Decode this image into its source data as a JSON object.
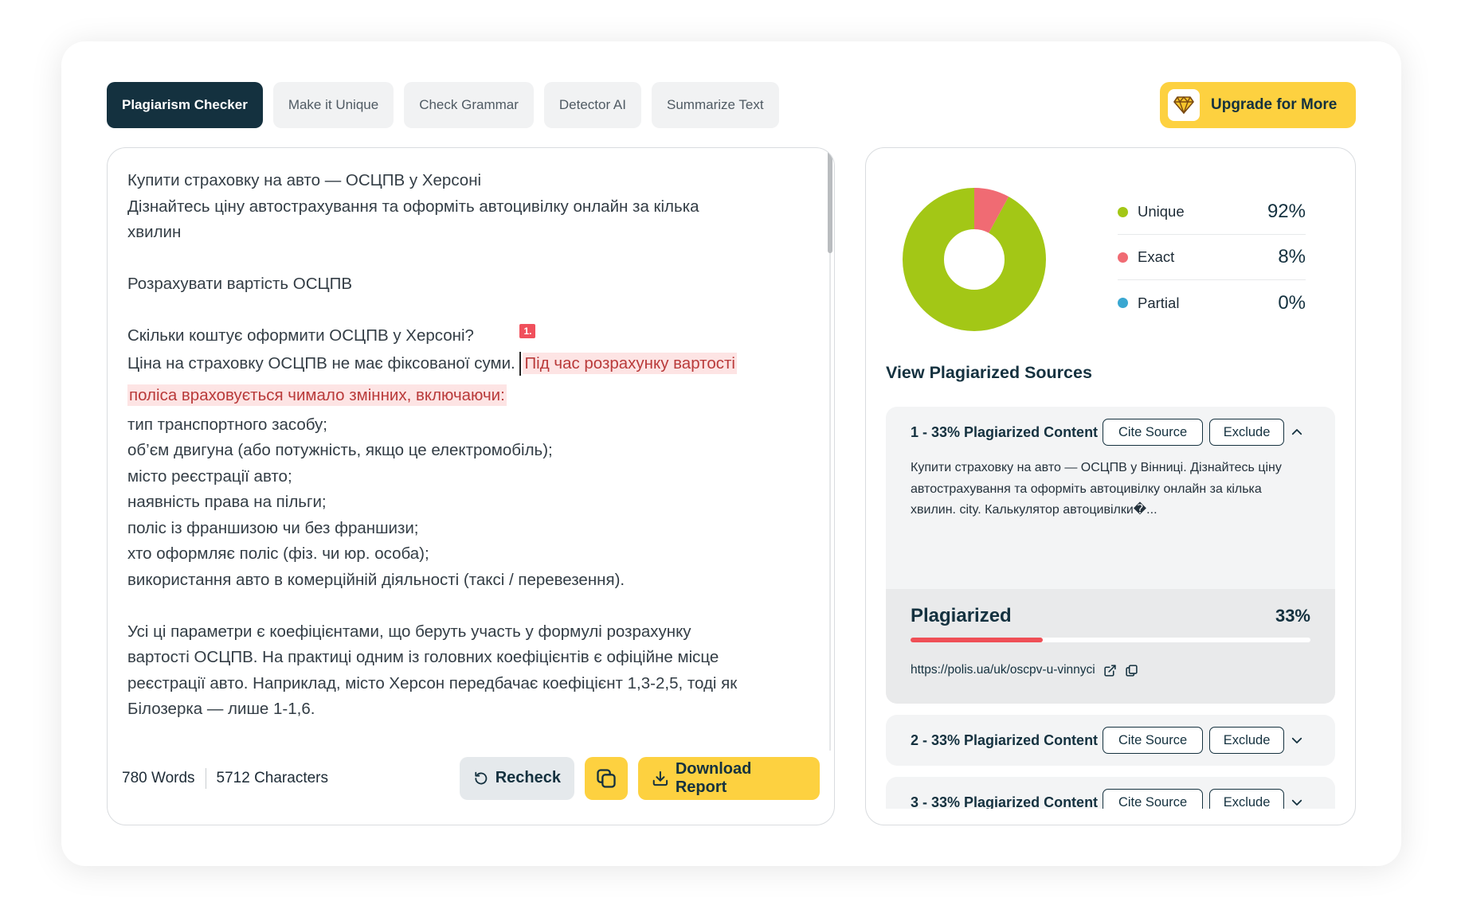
{
  "tabs": [
    {
      "label": "Plagiarism Checker",
      "active": true
    },
    {
      "label": "Make it Unique",
      "active": false
    },
    {
      "label": "Check Grammar",
      "active": false
    },
    {
      "label": "Detector AI",
      "active": false
    },
    {
      "label": "Summarize Text",
      "active": false
    }
  ],
  "upgrade": {
    "label": "Upgrade for More",
    "icon": "gem-icon"
  },
  "editor": {
    "lines_top": [
      "Купити страховку на авто — ОСЦПВ у Херсоні",
      "Дізнайтесь ціну автострахування та оформіть автоцивілку онлайн за кілька",
      "хвилин",
      "",
      "Розрахувати вартість ОСЦПВ",
      "",
      "Скільки коштує оформити ОСЦПВ у Херсоні?"
    ],
    "sentence_plain": "Ціна на страховку ОСЦПВ не має фіксованої суми.",
    "match_badge": "1.",
    "highlight_part1": "Під час розрахунку вартості",
    "highlight_part2": "поліса враховується чимало змінних, включаючи:",
    "lines_bottom": [
      "тип транспортного засобу;",
      "об’єм двигуна (або потужність, якщо це електромобіль);",
      "місто реєстрації авто;",
      "наявність права на пільги;",
      "поліс із франшизою чи без франшизи;",
      "хто оформляє поліс (фіз. чи юр. особа);",
      "використання авто в комерційній діяльності (таксі / перевезення).",
      "",
      "Усі ці параметри є коефіцієнтами, що беруть участь у формулі розрахунку",
      "вартості ОСЦПВ. На практиці одним із головних коефіцієнтів є офіційне місце",
      "реєстрації авто. Наприклад, місто Херсон передбачає коефіцієнт 1,3-2,5, тоді як",
      "Білозерка — лише 1-1,6."
    ],
    "words": "780 Words",
    "characters": "5712 Characters",
    "recheck_label": "Recheck",
    "download_label": "Download Report"
  },
  "results": {
    "chart_data": {
      "type": "pie",
      "categories": [
        "Unique",
        "Exact",
        "Partial"
      ],
      "values": [
        92,
        8,
        0
      ],
      "colors": [
        "#a3c716",
        "#f06b73",
        "#3aa7d1"
      ]
    },
    "legend": [
      {
        "label": "Unique",
        "value": "92%",
        "color": "#a3c716"
      },
      {
        "label": "Exact",
        "value": "8%",
        "color": "#f06b73"
      },
      {
        "label": "Partial",
        "value": "0%",
        "color": "#3aa7d1"
      }
    ],
    "sources_title": "View Plagiarized Sources",
    "sources": [
      {
        "title": "1 - 33% Plagiarized Content",
        "cite": "Cite Source",
        "exclude": "Exclude",
        "expanded": true,
        "excerpt": "Купити страховку на авто — ОСЦПВ у Вінниці. Дізнайтесь ціну автострахування та оформіть автоцивілку онлайн за кілька хвилин. city. Калькулятор автоцивілки�...",
        "plagiarized_label": "Plagiarized",
        "plagiarized_value": "33%",
        "plagiarized_fraction": 0.33,
        "url": "https://polis.ua/uk/oscpv-u-vinnyci"
      },
      {
        "title": "2 - 33% Plagiarized Content",
        "cite": "Cite Source",
        "exclude": "Exclude",
        "expanded": false
      },
      {
        "title": "3 - 33% Plagiarized Content",
        "cite": "Cite Source",
        "exclude": "Exclude",
        "expanded": false
      }
    ]
  }
}
